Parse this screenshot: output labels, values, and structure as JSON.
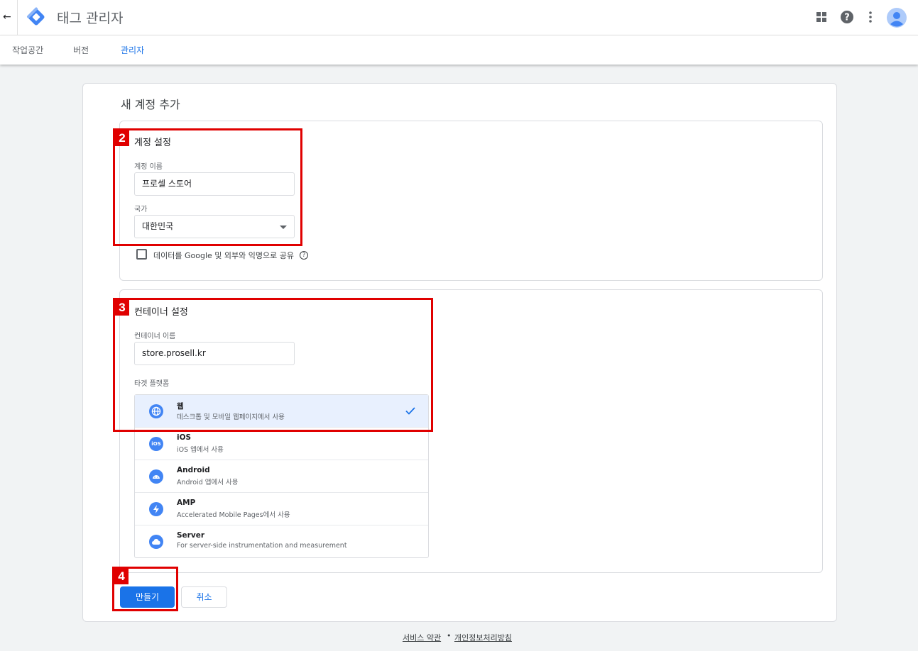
{
  "header": {
    "back_icon": "arrow-back-icon",
    "logo_icon": "tag-manager-logo",
    "app_title": "태그 관리자",
    "icons": [
      "apps-grid-icon",
      "help-icon",
      "more-vert-icon",
      "account-avatar-icon"
    ]
  },
  "tabs": [
    {
      "label": "작업공간",
      "active": false
    },
    {
      "label": "버전",
      "active": false
    },
    {
      "label": "관리자",
      "active": true
    }
  ],
  "form": {
    "title": "새 계정 추가",
    "account_section": {
      "title": "계정 설정",
      "name_label": "계정 이름",
      "name_value": "프로셀 스토어",
      "country_label": "국가",
      "country_value": "대한민국",
      "share_checkbox_label": "데이터를 Google 및 외부와 익명으로 공유",
      "share_checked": false
    },
    "container_section": {
      "title": "컨테이너 설정",
      "name_label": "컨테이너 이름",
      "name_value": "store.prosell.kr",
      "platform_label": "타겟 플랫폼",
      "platforms": [
        {
          "name": "웹",
          "desc": "데스크톱 및 모바일 웹페이지에서 사용",
          "icon": "globe-icon",
          "selected": true
        },
        {
          "name": "iOS",
          "desc": "iOS 앱에서 사용",
          "icon": "ios-icon",
          "selected": false
        },
        {
          "name": "Android",
          "desc": "Android 앱에서 사용",
          "icon": "android-icon",
          "selected": false
        },
        {
          "name": "AMP",
          "desc": "Accelerated Mobile Pages에서 사용",
          "icon": "amp-bolt-icon",
          "selected": false
        },
        {
          "name": "Server",
          "desc": "For server-side instrumentation and measurement",
          "icon": "cloud-icon",
          "selected": false
        }
      ]
    },
    "create_button": "만들기",
    "cancel_button": "취소"
  },
  "annotations": [
    "2",
    "3",
    "4"
  ],
  "footer": {
    "terms": "서비스 약관",
    "separator": "•",
    "privacy": "개인정보처리방침"
  },
  "colors": {
    "accent": "#1a73e8",
    "annotation": "#e00000",
    "selected_bg": "#e8f0fe"
  }
}
